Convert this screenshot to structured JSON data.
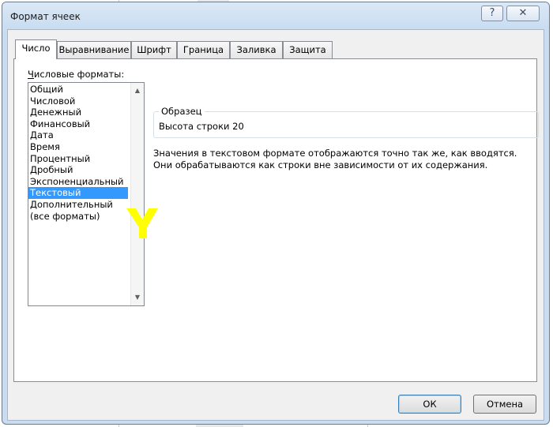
{
  "window": {
    "title": "Формат ячеек",
    "help_label": "?",
    "close_label": "✕"
  },
  "tabs": [
    {
      "label": "Число",
      "active": true
    },
    {
      "label": "Выравнивание"
    },
    {
      "label": "Шрифт"
    },
    {
      "label": "Граница"
    },
    {
      "label": "Заливка"
    },
    {
      "label": "Защита"
    }
  ],
  "number_formats": {
    "label": "Числовые форматы:",
    "label_accel": "Ч",
    "label_rest": "исловые форматы:",
    "items": [
      "Общий",
      "Числовой",
      "Денежный",
      "Финансовый",
      "Дата",
      "Время",
      "Процентный",
      "Дробный",
      "Экспоненциальный",
      "Текстовый",
      "Дополнительный",
      "(все форматы)"
    ],
    "selected_index": 9
  },
  "sample": {
    "legend": "Образец",
    "value": "Высота строки 20"
  },
  "description": "Значения в текстовом формате отображаются точно так же, как вводятся. Они обрабатываются как строки вне зависимости от их содержания.",
  "buttons": {
    "ok": "ОК",
    "cancel": "Отмена"
  },
  "colors": {
    "selection": "#3399ff",
    "annotation_mark": "#ffff00"
  }
}
